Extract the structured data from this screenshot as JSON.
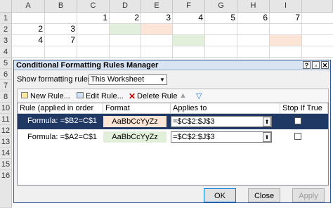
{
  "sheet": {
    "columns": [
      "A",
      "B",
      "C",
      "D",
      "E",
      "F",
      "G",
      "H",
      "I"
    ],
    "rows": [
      "1",
      "2",
      "3",
      "4",
      "5",
      "6",
      "7",
      "8",
      "9",
      "10",
      "11",
      "12",
      "13",
      "14",
      "15",
      "16"
    ],
    "row1": [
      "",
      "",
      "1",
      "2",
      "3",
      "4",
      "5",
      "6",
      "7"
    ],
    "row2": [
      "2",
      "3"
    ],
    "row3": [
      "4",
      "7"
    ],
    "fill_green": "#e2efda",
    "fill_pink": "#fce4d6"
  },
  "dialog": {
    "title": "Conditional Formatting Rules Manager",
    "show_label": "Show formatting rules for:",
    "scope_value": "This Worksheet",
    "toolbar": {
      "new_rule": "New Rule...",
      "edit_rule": "Edit Rule...",
      "delete_rule": "Delete Rule"
    },
    "columns": {
      "rule": "Rule (applied in order shown)",
      "format": "Format",
      "applies_to": "Applies to",
      "stop": "Stop If True"
    },
    "rules": [
      {
        "rule": "Formula: =$B2=C$1",
        "preview": "AaBbCcYyZz",
        "applies_to": "=$C$2:$J$3",
        "color": "#fce4d6"
      },
      {
        "rule": "Formula: =$A2=C$1",
        "preview": "AaBbCcYyZz",
        "applies_to": "=$C$2:$J$3",
        "color": "#e2efda"
      }
    ],
    "buttons": {
      "ok": "OK",
      "close": "Close",
      "apply": "Apply"
    },
    "selection_color": "#1f3864"
  }
}
